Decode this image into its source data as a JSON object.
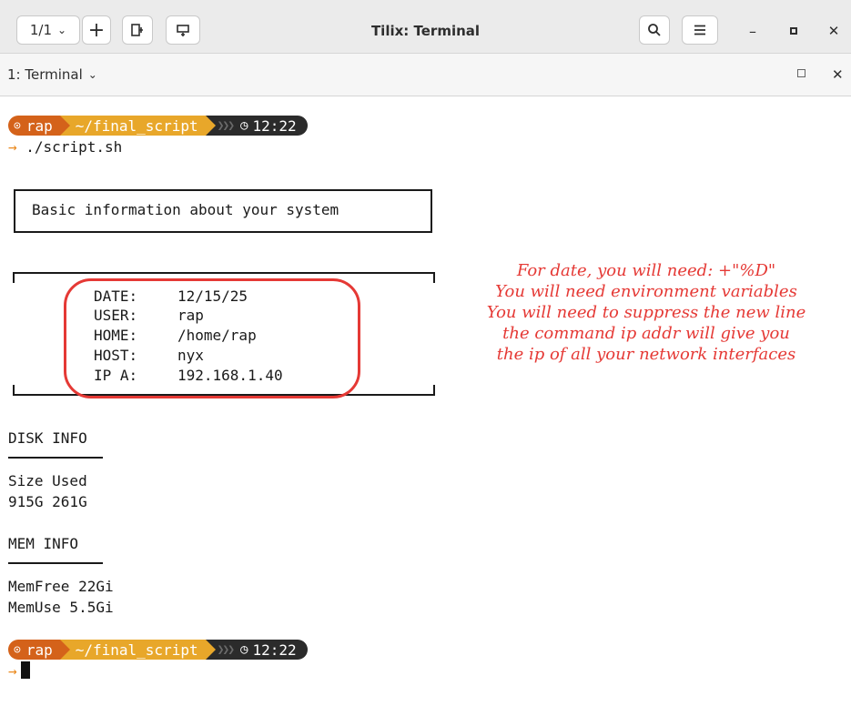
{
  "window": {
    "title": "Tilix: Terminal",
    "session_counter": "1/1",
    "tab_label": "1: Terminal"
  },
  "terminal": {
    "prompt1": {
      "user": "rap",
      "dir": "~/final_script",
      "time": "12:22"
    },
    "command": "./script.sh",
    "banner": "Basic information about your system",
    "sysinfo": [
      {
        "key": "DATE:",
        "value": "12/15/25"
      },
      {
        "key": "USER:",
        "value": "rap"
      },
      {
        "key": "HOME:",
        "value": "/home/rap"
      },
      {
        "key": "HOST:",
        "value": "nyx"
      },
      {
        "key": "IP A:",
        "value": "192.168.1.40"
      }
    ],
    "disk_title": "DISK INFO",
    "disk_header": "Size Used",
    "disk_values": "915G 261G",
    "mem_title": "MEM INFO",
    "mem_free": "MemFree 22Gi",
    "mem_use": "MemUse 5.5Gi",
    "prompt2": {
      "user": "rap",
      "dir": "~/final_script",
      "time": "12:22"
    }
  },
  "annotation": {
    "lines": [
      "For date, you will need: +\"%D\"",
      "You will need environment variables",
      "You will need to suppress the new line",
      "the command ip addr will give you",
      "the ip of all your network interfaces"
    ],
    "color": "#e53935"
  },
  "colors": {
    "prompt_user_bg": "#d4621a",
    "prompt_dir_bg": "#e8a72a",
    "prompt_time_bg": "#2b2b2b",
    "arrow": "#ea8a1f"
  }
}
